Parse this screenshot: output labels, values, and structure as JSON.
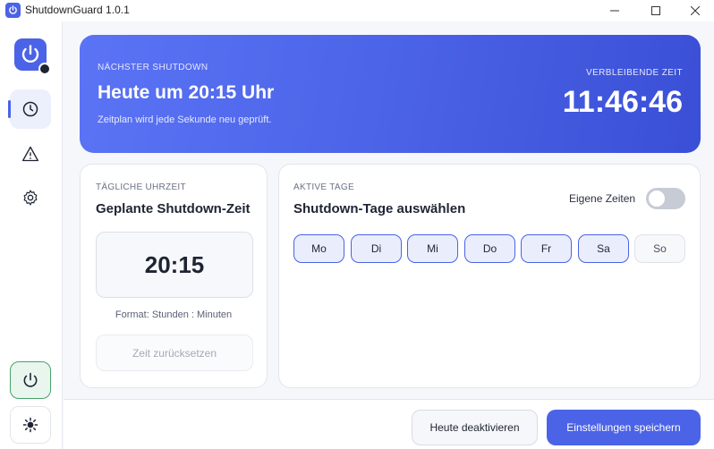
{
  "window": {
    "title": "ShutdownGuard 1.0.1",
    "minimize": "—",
    "maximize": "☐",
    "close": "✕"
  },
  "sidebar": {
    "items": [
      {
        "name": "schedule",
        "icon": "clock-icon",
        "active": true
      },
      {
        "name": "warnings",
        "icon": "warning-icon",
        "active": false
      },
      {
        "name": "settings",
        "icon": "gear-icon",
        "active": false
      }
    ],
    "power_icon": "power-icon",
    "theme_icon": "sun-icon"
  },
  "hero": {
    "kicker": "NÄCHSTER SHUTDOWN",
    "title": "Heute um 20:15 Uhr",
    "subtitle": "Zeitplan wird jede Sekunde neu geprüft.",
    "remaining_label": "VERBLEIBENDE ZEIT",
    "remaining": "11:46:46"
  },
  "time_card": {
    "kicker": "TÄGLICHE UHRZEIT",
    "title": "Geplante Shutdown-Zeit",
    "time": "20:15",
    "format": "Format: Stunden : Minuten",
    "reset": "Zeit zurücksetzen"
  },
  "days_card": {
    "kicker": "AKTIVE TAGE",
    "title": "Shutdown-Tage auswählen",
    "toggle_label": "Eigene Zeiten",
    "toggle_on": false,
    "days": [
      {
        "label": "Mo",
        "active": true
      },
      {
        "label": "Di",
        "active": true
      },
      {
        "label": "Mi",
        "active": true
      },
      {
        "label": "Do",
        "active": true
      },
      {
        "label": "Fr",
        "active": true
      },
      {
        "label": "Sa",
        "active": true
      },
      {
        "label": "So",
        "active": false
      }
    ]
  },
  "footer": {
    "disable_today": "Heute deaktivieren",
    "save": "Einstellungen speichern"
  },
  "colors": {
    "accent": "#4b63e6",
    "power_green": "#4aa16c"
  }
}
